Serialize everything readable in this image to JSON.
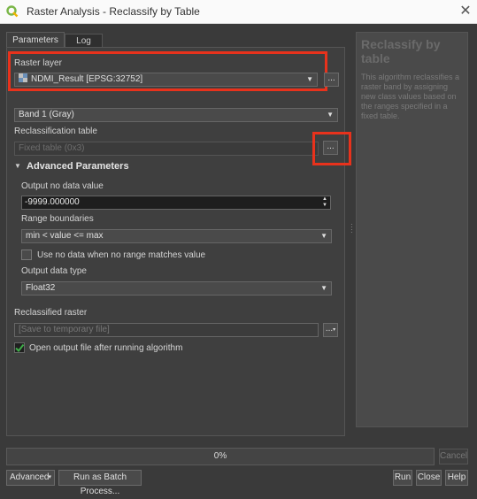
{
  "window": {
    "title": "Raster Analysis - Reclassify by Table",
    "close_glyph": "✕"
  },
  "tabs": [
    {
      "label": "Parameters"
    },
    {
      "label": "Log"
    }
  ],
  "params": {
    "raster_layer_label": "Raster layer",
    "raster_layer_value": "NDMI_Result [EPSG:32752]",
    "band_value": "Band 1 (Gray)",
    "reclass_table_label": "Reclassification table",
    "reclass_table_placeholder": "Fixed table (0x3)",
    "advanced_header": "Advanced Parameters",
    "nodata_label": "Output no data value",
    "nodata_value": "-9999.000000",
    "range_label": "Range boundaries",
    "range_value": "min < value <= max",
    "nodata_match_label": "Use no data when no range matches value",
    "output_type_label": "Output data type",
    "output_type_value": "Float32",
    "reclassified_label": "Reclassified raster",
    "reclassified_placeholder": "[Save to temporary file]",
    "open_output_label": "Open output file after running algorithm",
    "dots": "..."
  },
  "help": {
    "title": "Reclassify by table",
    "text": "This algorithm reclassifies a raster band by assigning new class values based on the ranges specified in a fixed table."
  },
  "footer": {
    "progress_text": "0%",
    "progress": 0,
    "cancel": "Cancel",
    "advanced": "Advanced",
    "batch": "Run as Batch Process...",
    "run": "Run",
    "close": "Close",
    "help": "Help"
  },
  "colors": {
    "highlight": "#e8321c",
    "check": "#3fae49"
  }
}
